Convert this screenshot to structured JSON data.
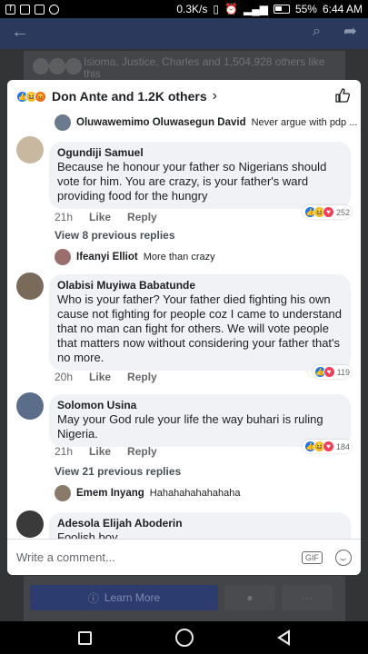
{
  "status_bar": {
    "speed": "0.3K/s",
    "battery": "55%",
    "time": "6:44 AM"
  },
  "background": {
    "likers_text": "Isioma, Justice, Charles and 1,504,928 others like this",
    "learn_more": "Learn More"
  },
  "modal": {
    "header_title": "Don Ante and 1.2K others",
    "entries": [
      {
        "kind": "reply",
        "name": "Oluwawemimo Oluwasegun David",
        "text": "Never argue with pdp ..."
      },
      {
        "kind": "comment",
        "name": "Ogundiji Samuel",
        "text": "Because he honour your father so Nigerians should vote for him. You are crazy, is your father's ward providing food for the hungry",
        "time": "21h",
        "like": "Like",
        "reply": "Reply",
        "reactions": "252"
      },
      {
        "kind": "view",
        "text": "View 8 previous replies"
      },
      {
        "kind": "reply",
        "name": "Ifeanyi Elliot",
        "text": "More than crazy"
      },
      {
        "kind": "comment",
        "name": "Olabisi Muyiwa Babatunde",
        "text": "Who is your father? Your father died fighting his own cause not fighting for people coz I came to understand that no man can fight for others. We will vote people that matters now without considering your father that's no more.",
        "time": "20h",
        "like": "Like",
        "reply": "Reply",
        "reactions": "119"
      },
      {
        "kind": "comment",
        "name": "Solomon Usina",
        "text": "May your God rule your life the way buhari is ruling Nigeria.",
        "time": "21h",
        "like": "Like",
        "reply": "Reply",
        "reactions": "184"
      },
      {
        "kind": "view",
        "text": "View 21 previous replies"
      },
      {
        "kind": "reply",
        "name": "Emem Inyang",
        "text": "Hahahahahahahaha"
      },
      {
        "kind": "comment",
        "name": "Adesola Elijah Aboderin",
        "text": "Foolish boy..."
      }
    ],
    "composer_placeholder": "Write a comment...",
    "gif_label": "GIF"
  }
}
